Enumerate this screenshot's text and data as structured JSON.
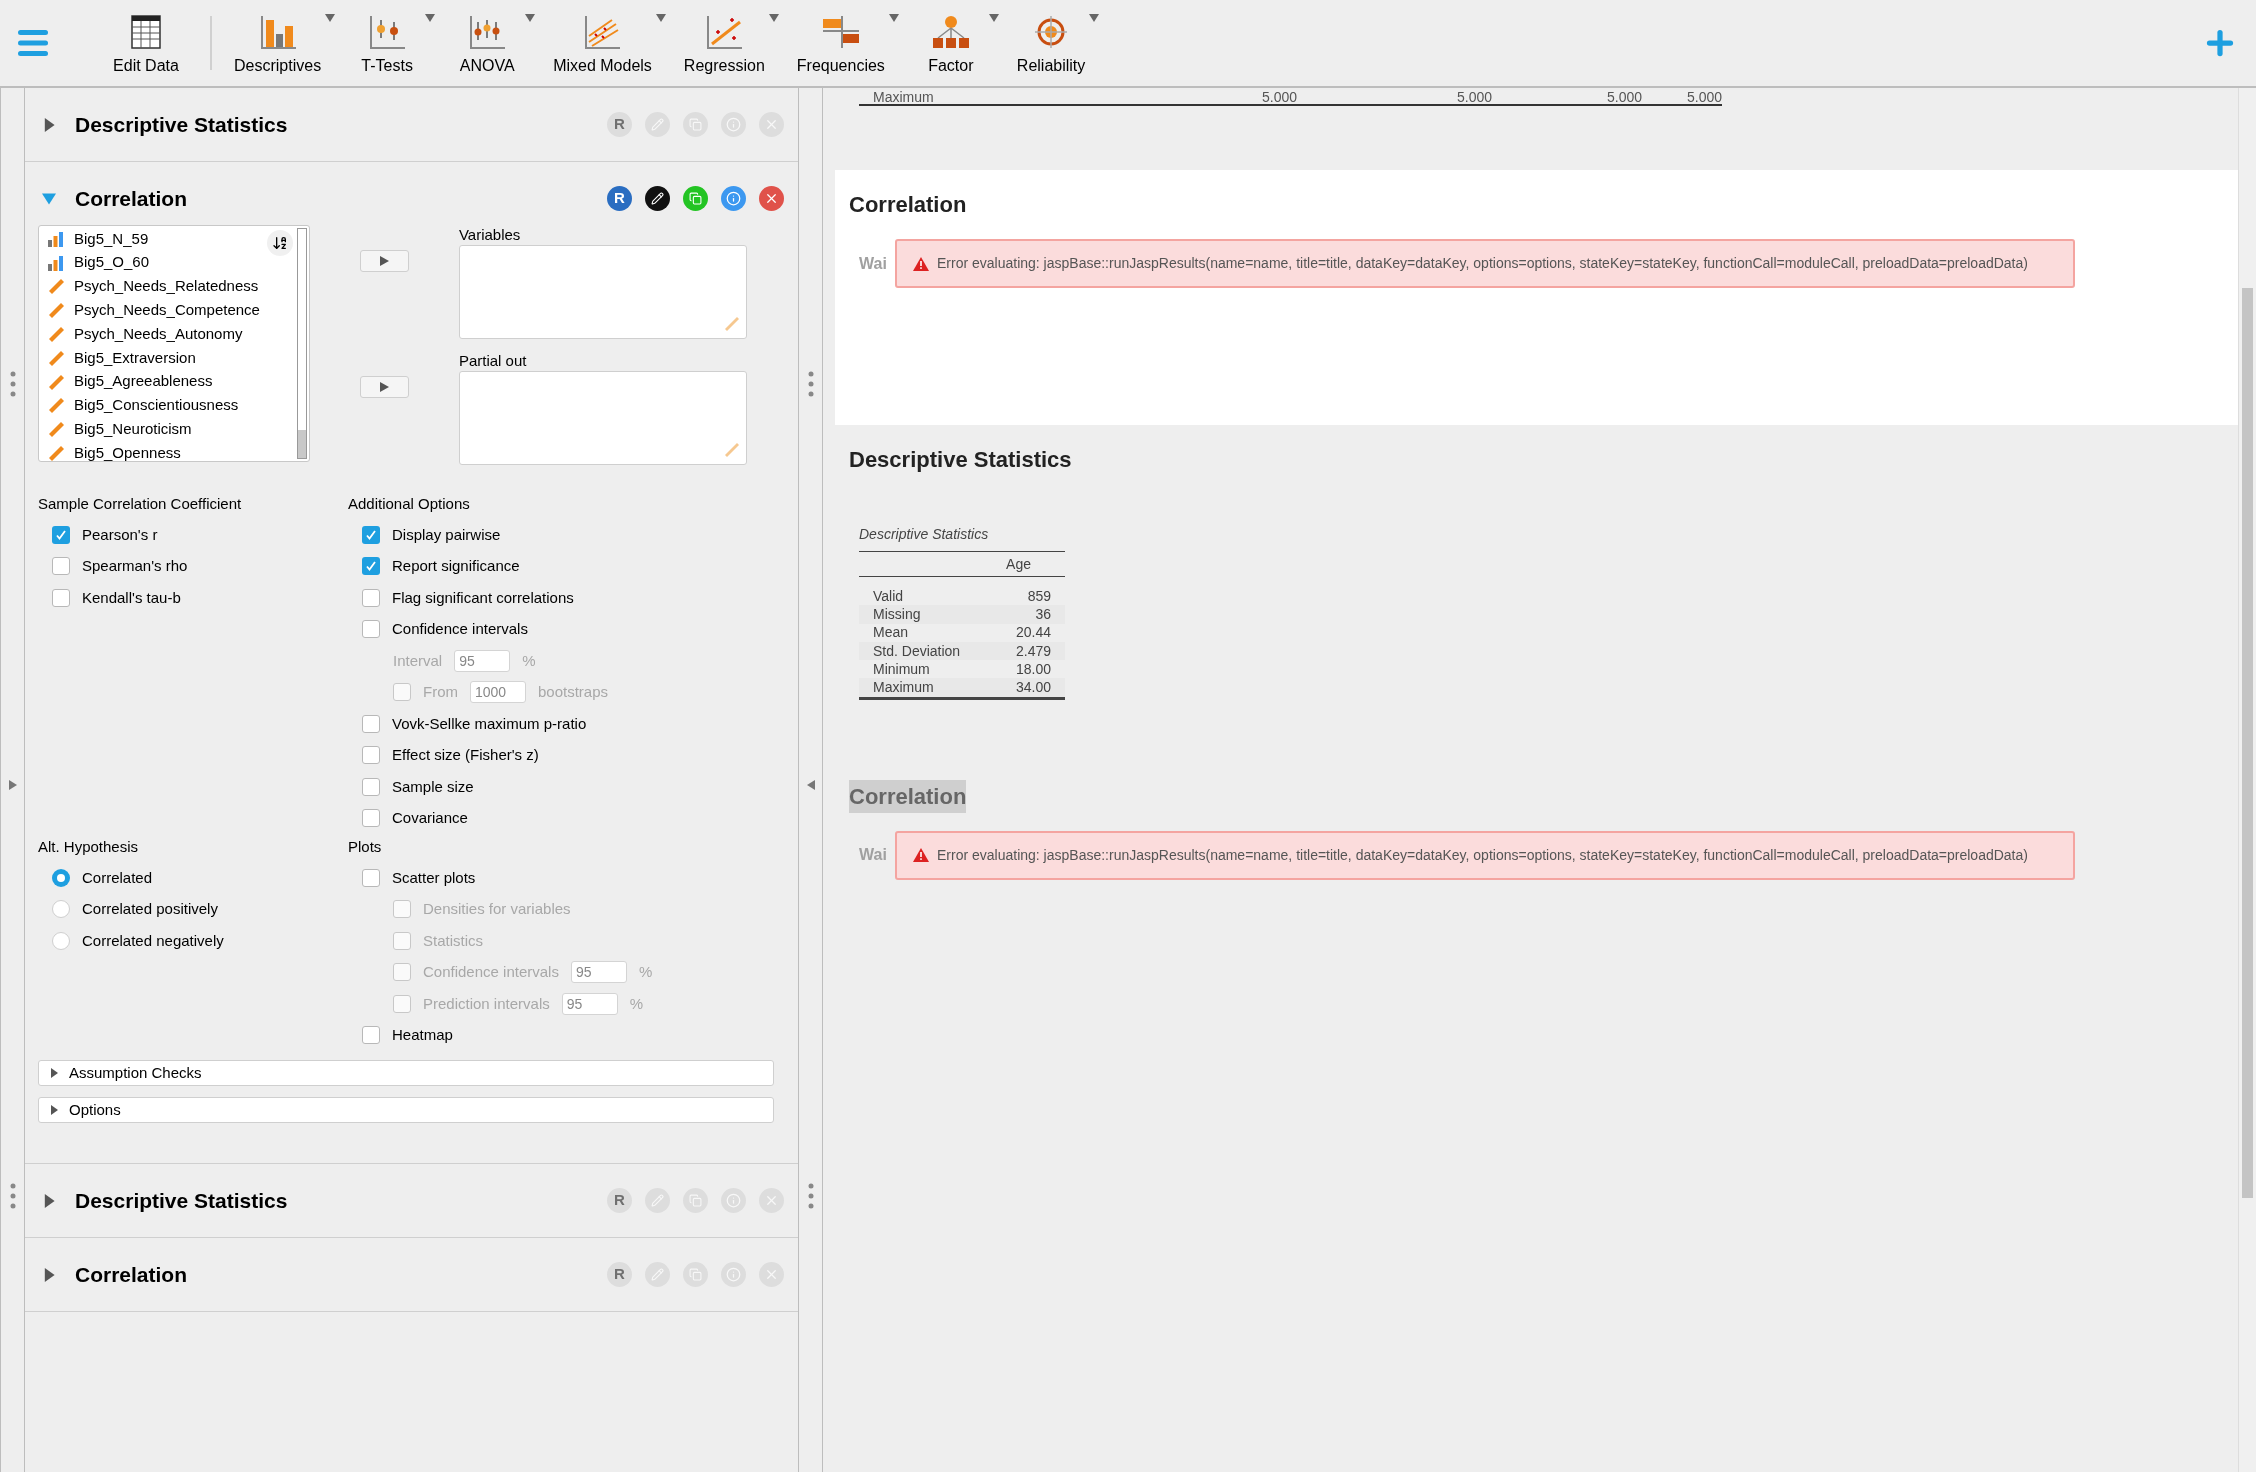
{
  "toolbar": {
    "items": [
      {
        "label": "Edit Data",
        "menu": false
      },
      {
        "label": "Descriptives",
        "menu": true
      },
      {
        "label": "T-Tests",
        "menu": true
      },
      {
        "label": "ANOVA",
        "menu": true
      },
      {
        "label": "Mixed Models",
        "menu": true
      },
      {
        "label": "Regression",
        "menu": true
      },
      {
        "label": "Frequencies",
        "menu": true
      },
      {
        "label": "Factor",
        "menu": true
      },
      {
        "label": "Reliability",
        "menu": true
      }
    ]
  },
  "analyses": [
    {
      "title": "Descriptive Statistics",
      "expanded": false,
      "active": false,
      "r_label": "R"
    },
    {
      "title": "Correlation",
      "expanded": true,
      "active": true,
      "r_label": "R",
      "form": {
        "variables": [
          {
            "name": "Big5_N_59",
            "kind": "ordinal"
          },
          {
            "name": "Big5_O_60",
            "kind": "ordinal"
          },
          {
            "name": "Psych_Needs_Relatedness",
            "kind": "scale"
          },
          {
            "name": "Psych_Needs_Competence",
            "kind": "scale"
          },
          {
            "name": "Psych_Needs_Autonomy",
            "kind": "scale"
          },
          {
            "name": "Big5_Extraversion",
            "kind": "scale"
          },
          {
            "name": "Big5_Agreeableness",
            "kind": "scale"
          },
          {
            "name": "Big5_Conscientiousness",
            "kind": "scale"
          },
          {
            "name": "Big5_Neuroticism",
            "kind": "scale"
          },
          {
            "name": "Big5_Openness",
            "kind": "scale"
          }
        ],
        "targets": [
          {
            "label": "Variables"
          },
          {
            "label": "Partial out"
          }
        ],
        "coefficient": {
          "title": "Sample Correlation Coefficient",
          "options": [
            {
              "kind": "checkbox",
              "label": "Pearson's r",
              "checked": true,
              "disabled": false
            },
            {
              "kind": "checkbox",
              "label": "Spearman's rho",
              "checked": false,
              "disabled": false
            },
            {
              "kind": "checkbox",
              "label": "Kendall's tau-b",
              "checked": false,
              "disabled": false
            }
          ]
        },
        "additional": {
          "title": "Additional Options",
          "options": [
            {
              "kind": "checkbox",
              "label": "Display pairwise",
              "checked": true,
              "disabled": false
            },
            {
              "kind": "checkbox",
              "label": "Report significance",
              "checked": true,
              "disabled": false
            },
            {
              "kind": "checkbox",
              "label": "Flag significant correlations",
              "checked": false,
              "disabled": false
            },
            {
              "kind": "checkbox",
              "label": "Confidence intervals",
              "checked": false,
              "disabled": false,
              "children": [
                {
                  "kind": "field",
                  "label": "Interval",
                  "value": "95",
                  "unit": "%",
                  "disabled": true
                },
                {
                  "kind": "checkbox",
                  "label": "From",
                  "checked": false,
                  "disabled": true,
                  "value": "1000",
                  "unit": "bootstraps"
                }
              ]
            },
            {
              "kind": "checkbox",
              "label": "Vovk-Sellke maximum p-ratio",
              "checked": false,
              "disabled": false
            },
            {
              "kind": "checkbox",
              "label": "Effect size (Fisher's z)",
              "checked": false,
              "disabled": false
            },
            {
              "kind": "checkbox",
              "label": "Sample size",
              "checked": false,
              "disabled": false
            },
            {
              "kind": "checkbox",
              "label": "Covariance",
              "checked": false,
              "disabled": false
            }
          ]
        },
        "hypothesis": {
          "title": "Alt. Hypothesis",
          "options": [
            {
              "label": "Correlated",
              "selected": true
            },
            {
              "label": "Correlated positively",
              "selected": false
            },
            {
              "label": "Correlated negatively",
              "selected": false
            }
          ]
        },
        "plots": {
          "title": "Plots",
          "options": [
            {
              "kind": "checkbox",
              "label": "Scatter plots",
              "checked": false,
              "disabled": false,
              "children": [
                {
                  "kind": "checkbox",
                  "label": "Densities for variables",
                  "checked": false,
                  "disabled": true
                },
                {
                  "kind": "checkbox",
                  "label": "Statistics",
                  "checked": false,
                  "disabled": true
                },
                {
                  "kind": "checkbox",
                  "label": "Confidence intervals",
                  "checked": false,
                  "disabled": true,
                  "value": "95",
                  "unit": "%"
                },
                {
                  "kind": "checkbox",
                  "label": "Prediction intervals",
                  "checked": false,
                  "disabled": true,
                  "value": "95",
                  "unit": "%"
                }
              ]
            },
            {
              "kind": "checkbox",
              "label": "Heatmap",
              "checked": false,
              "disabled": false
            }
          ]
        },
        "sections": [
          {
            "label": "Assumption Checks",
            "expanded": false
          },
          {
            "label": "Options",
            "expanded": false
          }
        ]
      }
    },
    {
      "title": "Descriptive Statistics",
      "expanded": false,
      "active": false,
      "r_label": "R"
    },
    {
      "title": "Correlation",
      "expanded": false,
      "active": false,
      "r_label": "R"
    }
  ],
  "output": {
    "table_tail": {
      "label": "Maximum",
      "values": [
        "5.000",
        "5.000",
        "5.000",
        "5.000"
      ]
    },
    "results": [
      {
        "kind": "error",
        "title": "Correlation",
        "selected": true,
        "highlighted": false,
        "waiting": "Wai",
        "error": "Error evaluating: jaspBase::runJaspResults(name=name, title=title, dataKey=dataKey, options=options, stateKey=stateKey, functionCall=moduleCall, preloadData=preloadData)"
      },
      {
        "kind": "table",
        "title": "Descriptive Statistics",
        "selected": false,
        "highlighted": false,
        "caption": "Descriptive Statistics",
        "column": "Age",
        "rows": [
          {
            "label": "Valid",
            "value": "859"
          },
          {
            "label": "Missing",
            "value": "36"
          },
          {
            "label": "Mean",
            "value": "20.44"
          },
          {
            "label": "Std. Deviation",
            "value": "2.479"
          },
          {
            "label": "Minimum",
            "value": "18.00"
          },
          {
            "label": "Maximum",
            "value": "34.00"
          }
        ]
      },
      {
        "kind": "error",
        "title": "Correlation",
        "selected": false,
        "highlighted": true,
        "waiting": "Wai",
        "error": "Error evaluating: jaspBase::runJaspResults(name=name, title=title, dataKey=dataKey, options=options, stateKey=stateKey, functionCall=moduleCall, preloadData=preloadData)"
      }
    ]
  }
}
